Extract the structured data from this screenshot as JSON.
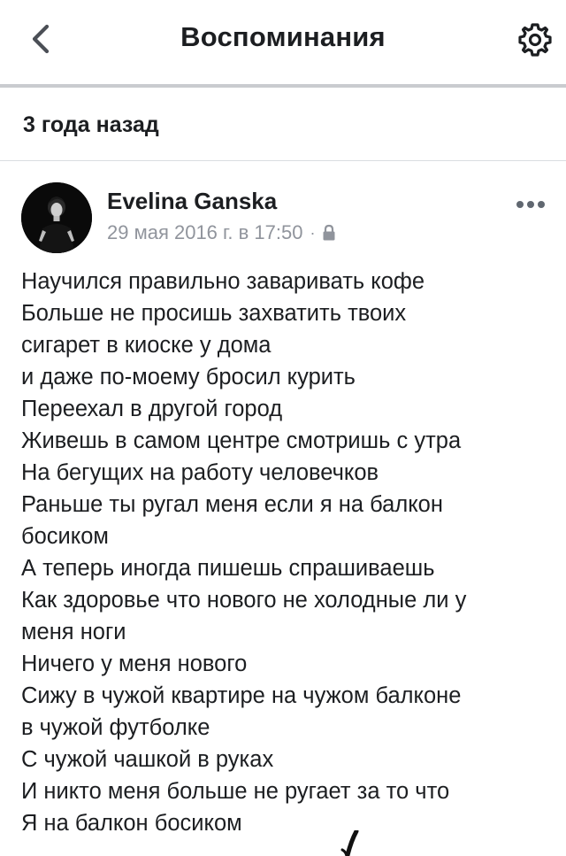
{
  "navbar": {
    "title": "Воспоминания",
    "back_icon": "chevron-left-icon",
    "settings_icon": "gear-icon"
  },
  "section": {
    "title": "3 года назад"
  },
  "post": {
    "author": "Evelina Ganska",
    "date": "29 мая 2016 г. в 17:50",
    "separator": "·",
    "privacy_icon": "lock-icon",
    "more_icon": "more-dots-icon",
    "lines": [
      "Научился правильно заваривать кофе",
      "Больше не просишь захватить твоих",
      "сигарет в киоске у дома",
      "и даже по-моему бросил курить",
      "Переехал в другой город",
      "Живешь в самом центре смотришь с утра",
      "На бегущих на работу человечков",
      "Раньше ты ругал меня если я на балкон",
      "босиком",
      "А теперь иногда пишешь спрашиваешь",
      "Как здоровье что нового не холодные ли у",
      "меня ноги",
      "Ничего у меня нового",
      "Сижу в чужой квартире на чужом балконе",
      "в чужой футболке",
      "С чужой чашкой в руках",
      "И никто меня больше не ругает за то что",
      "Я на балкон босиком"
    ]
  },
  "colors": {
    "text": "#1c1e21",
    "secondary": "#90949c",
    "divider": "#c9cbcf",
    "icon": "#4b4f56"
  }
}
